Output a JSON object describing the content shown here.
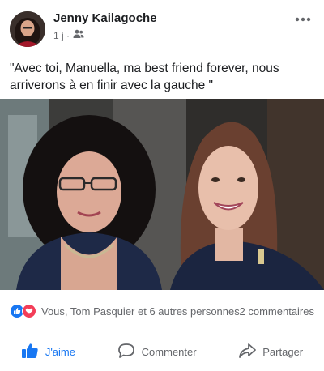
{
  "post": {
    "author": "Jenny Kailagoche",
    "time": "1 j ·",
    "text": "\"Avec toi, Manuella, ma best friend forever, nous arriverons à en finir avec la gauche \""
  },
  "reactions": {
    "summary": "Vous, Tom Pasquier et 6 autres personnes",
    "comments": "2 commentaires"
  },
  "actions": {
    "like": "J'aime",
    "comment": "Commenter",
    "share": "Partager"
  },
  "colors": {
    "like_blue": "#1877f2",
    "love_red": "#f33e58",
    "muted": "#65676b"
  },
  "icons": [
    "more-options-icon",
    "friends-audience-icon",
    "like-reaction-icon",
    "love-reaction-icon",
    "thumbs-up-icon",
    "comment-icon",
    "share-icon"
  ]
}
